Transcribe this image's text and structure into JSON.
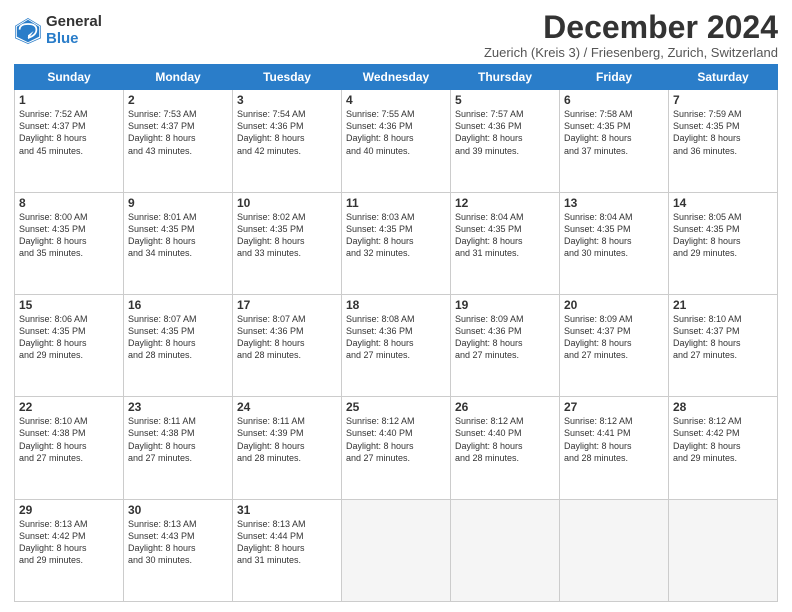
{
  "logo": {
    "general": "General",
    "blue": "Blue"
  },
  "title": "December 2024",
  "subtitle": "Zuerich (Kreis 3) / Friesenberg, Zurich, Switzerland",
  "header_days": [
    "Sunday",
    "Monday",
    "Tuesday",
    "Wednesday",
    "Thursday",
    "Friday",
    "Saturday"
  ],
  "weeks": [
    [
      {
        "day": "1",
        "lines": [
          "Sunrise: 7:52 AM",
          "Sunset: 4:37 PM",
          "Daylight: 8 hours",
          "and 45 minutes."
        ]
      },
      {
        "day": "2",
        "lines": [
          "Sunrise: 7:53 AM",
          "Sunset: 4:37 PM",
          "Daylight: 8 hours",
          "and 43 minutes."
        ]
      },
      {
        "day": "3",
        "lines": [
          "Sunrise: 7:54 AM",
          "Sunset: 4:36 PM",
          "Daylight: 8 hours",
          "and 42 minutes."
        ]
      },
      {
        "day": "4",
        "lines": [
          "Sunrise: 7:55 AM",
          "Sunset: 4:36 PM",
          "Daylight: 8 hours",
          "and 40 minutes."
        ]
      },
      {
        "day": "5",
        "lines": [
          "Sunrise: 7:57 AM",
          "Sunset: 4:36 PM",
          "Daylight: 8 hours",
          "and 39 minutes."
        ]
      },
      {
        "day": "6",
        "lines": [
          "Sunrise: 7:58 AM",
          "Sunset: 4:35 PM",
          "Daylight: 8 hours",
          "and 37 minutes."
        ]
      },
      {
        "day": "7",
        "lines": [
          "Sunrise: 7:59 AM",
          "Sunset: 4:35 PM",
          "Daylight: 8 hours",
          "and 36 minutes."
        ]
      }
    ],
    [
      {
        "day": "8",
        "lines": [
          "Sunrise: 8:00 AM",
          "Sunset: 4:35 PM",
          "Daylight: 8 hours",
          "and 35 minutes."
        ]
      },
      {
        "day": "9",
        "lines": [
          "Sunrise: 8:01 AM",
          "Sunset: 4:35 PM",
          "Daylight: 8 hours",
          "and 34 minutes."
        ]
      },
      {
        "day": "10",
        "lines": [
          "Sunrise: 8:02 AM",
          "Sunset: 4:35 PM",
          "Daylight: 8 hours",
          "and 33 minutes."
        ]
      },
      {
        "day": "11",
        "lines": [
          "Sunrise: 8:03 AM",
          "Sunset: 4:35 PM",
          "Daylight: 8 hours",
          "and 32 minutes."
        ]
      },
      {
        "day": "12",
        "lines": [
          "Sunrise: 8:04 AM",
          "Sunset: 4:35 PM",
          "Daylight: 8 hours",
          "and 31 minutes."
        ]
      },
      {
        "day": "13",
        "lines": [
          "Sunrise: 8:04 AM",
          "Sunset: 4:35 PM",
          "Daylight: 8 hours",
          "and 30 minutes."
        ]
      },
      {
        "day": "14",
        "lines": [
          "Sunrise: 8:05 AM",
          "Sunset: 4:35 PM",
          "Daylight: 8 hours",
          "and 29 minutes."
        ]
      }
    ],
    [
      {
        "day": "15",
        "lines": [
          "Sunrise: 8:06 AM",
          "Sunset: 4:35 PM",
          "Daylight: 8 hours",
          "and 29 minutes."
        ]
      },
      {
        "day": "16",
        "lines": [
          "Sunrise: 8:07 AM",
          "Sunset: 4:35 PM",
          "Daylight: 8 hours",
          "and 28 minutes."
        ]
      },
      {
        "day": "17",
        "lines": [
          "Sunrise: 8:07 AM",
          "Sunset: 4:36 PM",
          "Daylight: 8 hours",
          "and 28 minutes."
        ]
      },
      {
        "day": "18",
        "lines": [
          "Sunrise: 8:08 AM",
          "Sunset: 4:36 PM",
          "Daylight: 8 hours",
          "and 27 minutes."
        ]
      },
      {
        "day": "19",
        "lines": [
          "Sunrise: 8:09 AM",
          "Sunset: 4:36 PM",
          "Daylight: 8 hours",
          "and 27 minutes."
        ]
      },
      {
        "day": "20",
        "lines": [
          "Sunrise: 8:09 AM",
          "Sunset: 4:37 PM",
          "Daylight: 8 hours",
          "and 27 minutes."
        ]
      },
      {
        "day": "21",
        "lines": [
          "Sunrise: 8:10 AM",
          "Sunset: 4:37 PM",
          "Daylight: 8 hours",
          "and 27 minutes."
        ]
      }
    ],
    [
      {
        "day": "22",
        "lines": [
          "Sunrise: 8:10 AM",
          "Sunset: 4:38 PM",
          "Daylight: 8 hours",
          "and 27 minutes."
        ]
      },
      {
        "day": "23",
        "lines": [
          "Sunrise: 8:11 AM",
          "Sunset: 4:38 PM",
          "Daylight: 8 hours",
          "and 27 minutes."
        ]
      },
      {
        "day": "24",
        "lines": [
          "Sunrise: 8:11 AM",
          "Sunset: 4:39 PM",
          "Daylight: 8 hours",
          "and 28 minutes."
        ]
      },
      {
        "day": "25",
        "lines": [
          "Sunrise: 8:12 AM",
          "Sunset: 4:40 PM",
          "Daylight: 8 hours",
          "and 27 minutes."
        ]
      },
      {
        "day": "26",
        "lines": [
          "Sunrise: 8:12 AM",
          "Sunset: 4:40 PM",
          "Daylight: 8 hours",
          "and 28 minutes."
        ]
      },
      {
        "day": "27",
        "lines": [
          "Sunrise: 8:12 AM",
          "Sunset: 4:41 PM",
          "Daylight: 8 hours",
          "and 28 minutes."
        ]
      },
      {
        "day": "28",
        "lines": [
          "Sunrise: 8:12 AM",
          "Sunset: 4:42 PM",
          "Daylight: 8 hours",
          "and 29 minutes."
        ]
      }
    ],
    [
      {
        "day": "29",
        "lines": [
          "Sunrise: 8:13 AM",
          "Sunset: 4:42 PM",
          "Daylight: 8 hours",
          "and 29 minutes."
        ]
      },
      {
        "day": "30",
        "lines": [
          "Sunrise: 8:13 AM",
          "Sunset: 4:43 PM",
          "Daylight: 8 hours",
          "and 30 minutes."
        ]
      },
      {
        "day": "31",
        "lines": [
          "Sunrise: 8:13 AM",
          "Sunset: 4:44 PM",
          "Daylight: 8 hours",
          "and 31 minutes."
        ]
      },
      null,
      null,
      null,
      null
    ]
  ]
}
